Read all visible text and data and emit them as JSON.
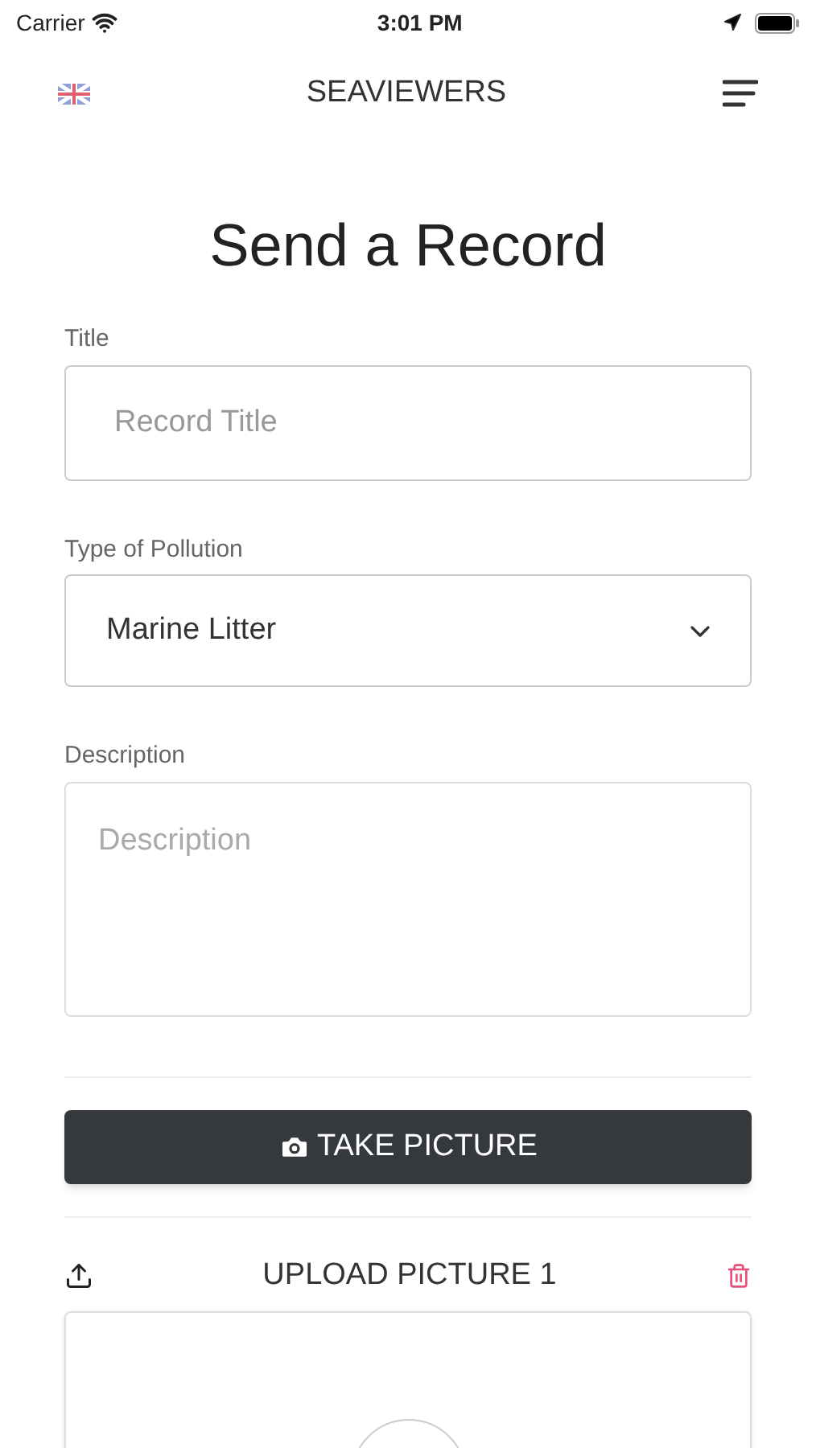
{
  "status_bar": {
    "carrier": "Carrier",
    "time": "3:01 PM"
  },
  "nav": {
    "title": "SEAVIEWERS"
  },
  "page_title": "Send a Record",
  "fields": [
    {
      "kind": "input",
      "label": "Title",
      "placeholder": "Record Title"
    },
    {
      "kind": "select",
      "label": "Type of Pollution",
      "value": "Marine Litter"
    },
    {
      "kind": "textarea",
      "label": "Description",
      "placeholder": "Description"
    }
  ],
  "take_picture_button": "TAKE PICTURE",
  "upload": {
    "title": "UPLOAD PICTURE 1"
  }
}
